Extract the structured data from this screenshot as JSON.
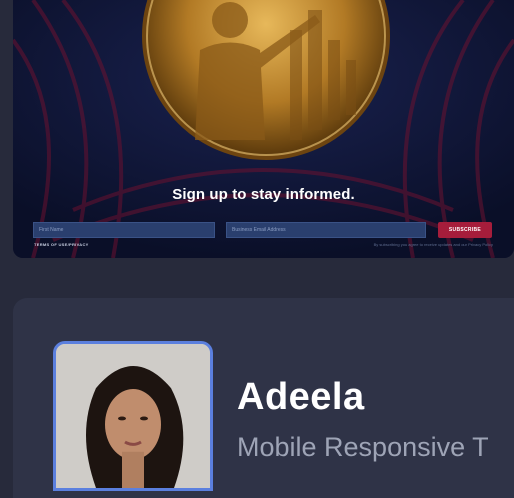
{
  "newsletter": {
    "heading": "Sign up to stay informed.",
    "first_name_placeholder": "First Name",
    "email_placeholder": "Business Email Address",
    "subscribe_label": "SUBSCRIBE",
    "terms_link": "TERMS OF USE/PRIVACY",
    "privacy_note": "By subscribing you agree to receive updates and our Privacy Policy"
  },
  "profile": {
    "name": "Adeela",
    "role": "Mobile Responsive T"
  },
  "colors": {
    "page_bg": "#272a3b",
    "banner_bg": "#0d1230",
    "accent_red": "#a61d3b",
    "photo_border": "#5b7fde",
    "card_bg": "#2f3347"
  }
}
